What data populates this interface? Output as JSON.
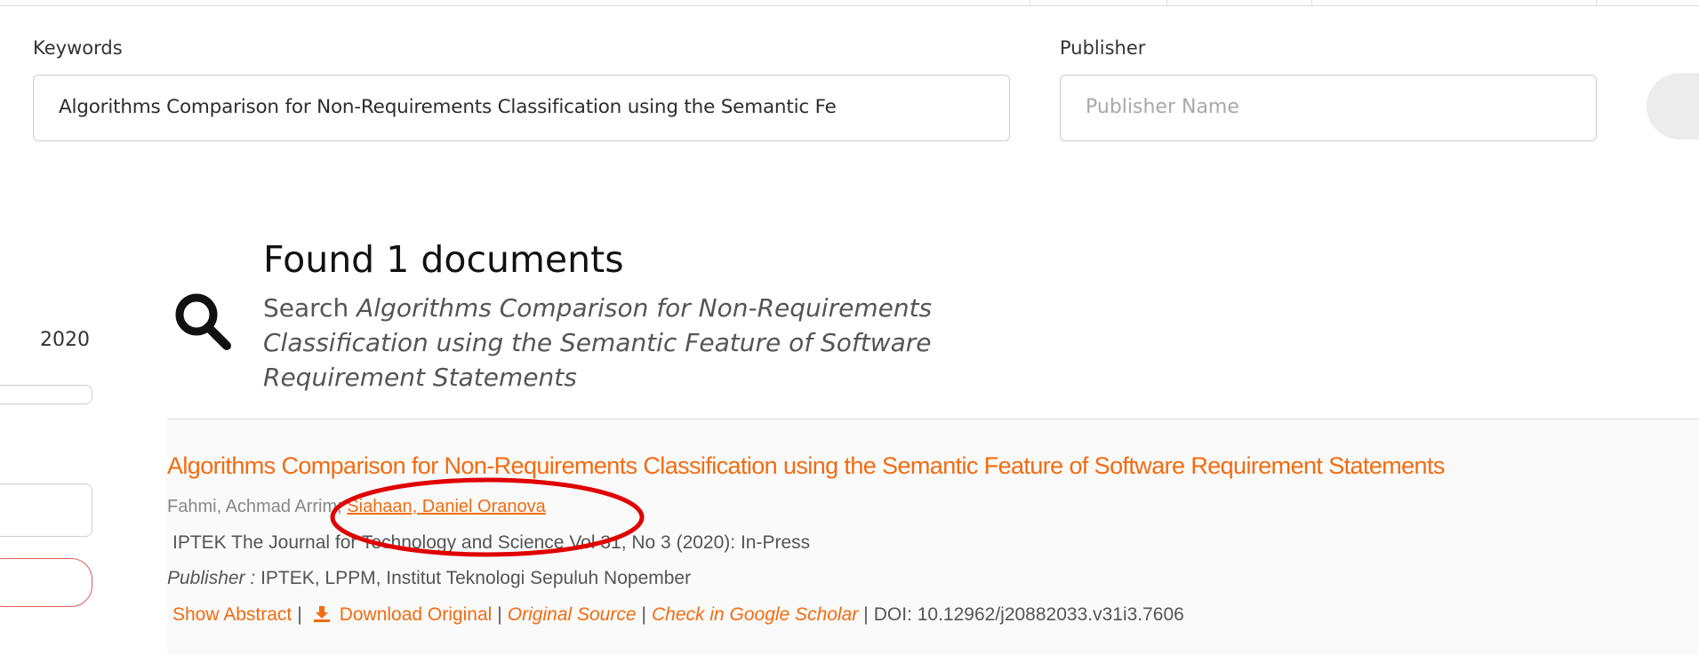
{
  "form": {
    "keywords_label": "Keywords",
    "keywords_value": "Algorithms Comparison for Non-Requirements Classification using the Semantic Fe",
    "publisher_label": "Publisher",
    "publisher_placeholder": "Publisher Name"
  },
  "sidebar": {
    "year": "2020"
  },
  "results_header": {
    "title": "Found 1 documents",
    "search_prefix": "Search",
    "search_query": "Algorithms Comparison for Non-Requirements Classification using the Semantic Feature of Software Requirement Statements"
  },
  "results": [
    {
      "title": "Algorithms Comparison for Non-Requirements Classification using the Semantic Feature of Software Requirement Statements",
      "author_1": "Fahmi, Achmad Arrim;",
      "author_2": "Siahaan, Daniel Oranova",
      "journal": "IPTEK The Journal for Technology and Science Vol 31, No 3 (2020): In-Press",
      "publisher_label": "Publisher :",
      "publisher_value": "IPTEK, LPPM, Institut Teknologi Sepuluh Nopember",
      "actions": {
        "show_abstract": "Show Abstract",
        "download": "Download Original",
        "original_source": "Original Source",
        "google_scholar": "Check in Google Scholar",
        "doi": "DOI: 10.12962/j20882033.v31i3.7606"
      }
    }
  ],
  "colors": {
    "accent": "#f36b10",
    "annotation": "#e00000"
  },
  "icons": {
    "search": "search-icon",
    "download": "download-icon"
  }
}
